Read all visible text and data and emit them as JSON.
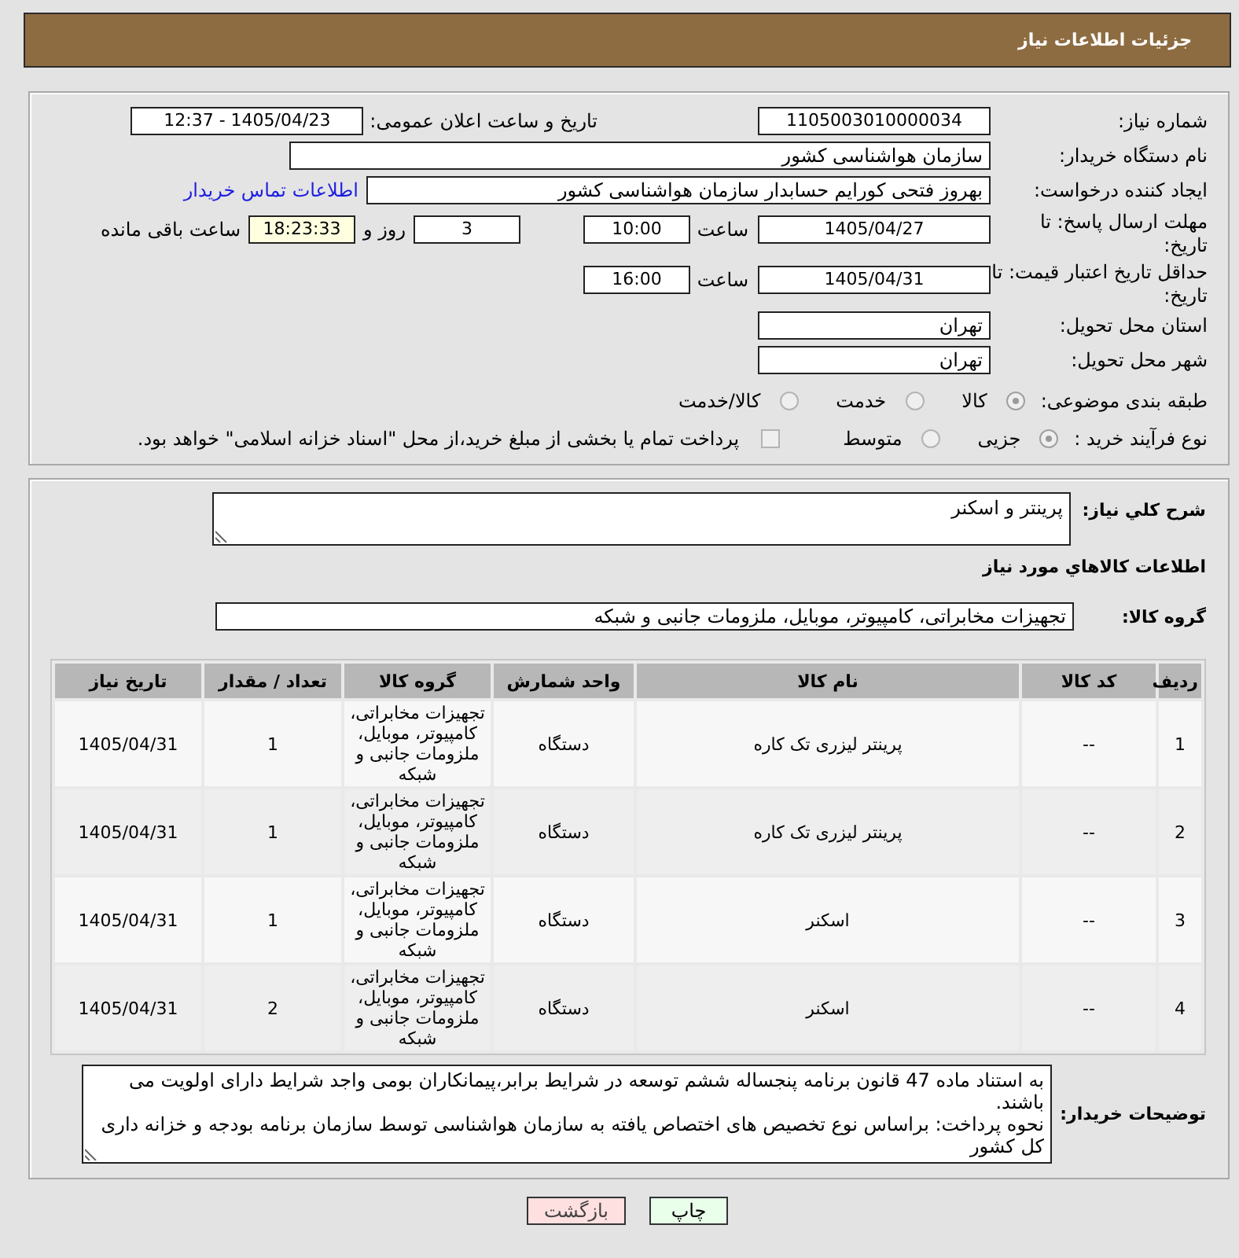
{
  "header": {
    "title": "جزئیات اطلاعات نیاز"
  },
  "need_number": {
    "label": "شماره نیاز:",
    "value": "1105003010000034"
  },
  "announce_datetime": {
    "label": "تاریخ و ساعت اعلان عمومی:",
    "value": "1405/04/23 - 12:37"
  },
  "buyer_org": {
    "label": "نام دستگاه خریدار:",
    "value": "سازمان هواشناسی کشور"
  },
  "requester": {
    "label": "ایجاد کننده درخواست:",
    "value": "بهروز فتحی کورایم حسابدار سازمان هواشناسی کشور",
    "link": "اطلاعات تماس خریدار"
  },
  "response_deadline": {
    "label": "مهلت ارسال پاسخ: تا تاریخ:",
    "date": "1405/04/27",
    "time_label": "ساعت",
    "time": "10:00",
    "days": "3",
    "days_label": "روز و",
    "remaining": "18:23:33",
    "remaining_label": "ساعت باقی مانده"
  },
  "price_validity": {
    "label": "حداقل تاریخ اعتبار قیمت: تا تاریخ:",
    "date": "1405/04/31",
    "time_label": "ساعت",
    "time": "16:00"
  },
  "delivery_province": {
    "label": "استان محل تحویل:",
    "value": "تهران"
  },
  "delivery_city": {
    "label": "شهر محل تحویل:",
    "value": "تهران"
  },
  "category": {
    "label": "طبقه بندی موضوعی:",
    "options": [
      {
        "label": "کالا",
        "selected": true
      },
      {
        "label": "خدمت",
        "selected": false
      },
      {
        "label": "کالا/خدمت",
        "selected": false
      }
    ]
  },
  "purchase_process": {
    "label": "نوع فرآیند خرید :",
    "options": [
      {
        "label": "جزیی",
        "selected": true
      },
      {
        "label": "متوسط",
        "selected": false
      }
    ],
    "treasury": {
      "label": "پرداخت تمام یا بخشی از مبلغ خرید،از محل \"اسناد خزانه اسلامی\" خواهد بود.",
      "checked": false
    }
  },
  "description": {
    "label": "شرح کلي نیاز:",
    "value": "پرینتر و اسکنر"
  },
  "goods_section_title": "اطلاعات کالاهاي مورد نیاز",
  "goods_group": {
    "label": "گروه کالا:",
    "value": "تجهیزات مخابراتی، کامپیوتر، موبایل، ملزومات جانبی و شبکه"
  },
  "table": {
    "columns": [
      "ردیف",
      "کد کالا",
      "نام کالا",
      "واحد شمارش",
      "گروه کالا",
      "تعداد / مقدار",
      "تاریخ نیاز"
    ],
    "rows": [
      [
        "1",
        "--",
        "پرینتر لیزری تک کاره",
        "دستگاه",
        "تجهیزات مخابراتی، کامپیوتر، موبایل، ملزومات جانبی و شبکه",
        "1",
        "1405/04/31"
      ],
      [
        "2",
        "--",
        "پرینتر لیزری تک کاره",
        "دستگاه",
        "تجهیزات مخابراتی، کامپیوتر، موبایل، ملزومات جانبی و شبکه",
        "1",
        "1405/04/31"
      ],
      [
        "3",
        "--",
        "اسکنر",
        "دستگاه",
        "تجهیزات مخابراتی، کامپیوتر، موبایل، ملزومات جانبی و شبکه",
        "1",
        "1405/04/31"
      ],
      [
        "4",
        "--",
        "اسکنر",
        "دستگاه",
        "تجهیزات مخابراتی، کامپیوتر، موبایل، ملزومات جانبی و شبکه",
        "2",
        "1405/04/31"
      ]
    ]
  },
  "buyer_notes": {
    "label": "توضیحات خریدار:",
    "lines": [
      "به استناد ماده 47 قانون برنامه پنجساله ششم توسعه در شرایط برابر،پیمانکاران بومی واجد شرایط دارای اولویت می باشند.",
      "نحوه پرداخت: براساس نوع تخصیص های اختصاص یافته به سازمان هواشناسی توسط سازمان برنامه بودجه و خزانه داری کل کشور"
    ]
  },
  "buttons": [
    {
      "label": "چاپ",
      "kind": "print"
    },
    {
      "label": "بازگشت",
      "kind": "back"
    }
  ]
}
